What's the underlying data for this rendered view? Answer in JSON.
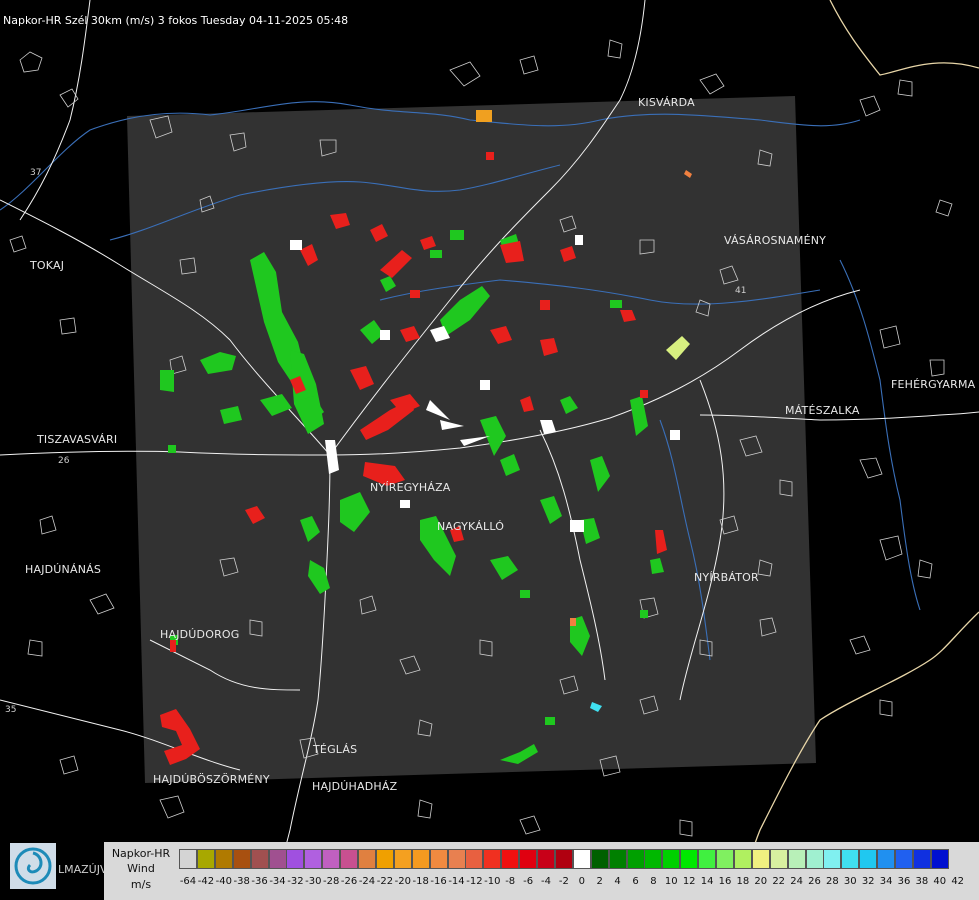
{
  "header": {
    "title": "Napkor-HR Szél 30km (m/s) 3 fokos Tuesday 04-11-2025 05:48"
  },
  "cities": [
    {
      "id": "kisvarda",
      "label": "KISVÁRDA"
    },
    {
      "id": "tokaj",
      "label": "TOKAJ"
    },
    {
      "id": "vasarosnameny",
      "label": "VÁSÁROSNAMÉNY"
    },
    {
      "id": "fehergyarmat",
      "label": "FEHÉRGYARMA"
    },
    {
      "id": "mateszalka",
      "label": "MÁTÉSZALKA"
    },
    {
      "id": "tiszavasvari",
      "label": "TISZAVASVÁRI"
    },
    {
      "id": "nyiregyhaza",
      "label": "NYÍREGYHÁZA"
    },
    {
      "id": "nagykallo",
      "label": "NAGYKÁLLÓ"
    },
    {
      "id": "hajdunanas",
      "label": "HAJDÚNÁNÁS"
    },
    {
      "id": "nyirbator",
      "label": "NYÍRBÁTOR"
    },
    {
      "id": "hajdudorog",
      "label": "HAJDÚDOROG"
    },
    {
      "id": "teglas",
      "label": "TÉGLÁS"
    },
    {
      "id": "hajduboszormeny",
      "label": "HAJDÚBÖSZÖRMÉNY"
    },
    {
      "id": "hajduhadhaz",
      "label": "HAJDÚHADHÁZ"
    }
  ],
  "road_labels": {
    "r26": "26",
    "r41": "41",
    "r35": "35",
    "r37": "37"
  },
  "logo": {
    "text": "LMAZÚJVÁR",
    "icon": "swirl-logo-icon"
  },
  "legend": {
    "title_lines": [
      "Napkor-HR",
      "Wind",
      "m/s"
    ],
    "colors": [
      "#d4d4d4",
      "#a8a800",
      "#b07a00",
      "#a85010",
      "#a05050",
      "#a05090",
      "#a050e0",
      "#b060e0",
      "#c060c0",
      "#c85090",
      "#e08040",
      "#f0a000",
      "#f4a020",
      "#f49a20",
      "#f08a40",
      "#e88050",
      "#e86040",
      "#f03020",
      "#f01010",
      "#e00010",
      "#c80018",
      "#b00010",
      "#ffffff",
      "#006000",
      "#008000",
      "#00a000",
      "#00b800",
      "#00d000",
      "#00e800",
      "#40f040",
      "#80f060",
      "#b0f060",
      "#f0f080",
      "#d8f0a0",
      "#b8f0b8",
      "#a0f0d0",
      "#80f0f0",
      "#40e0f0",
      "#20c8f0",
      "#2090f0",
      "#2060f0",
      "#1030e0",
      "#0010d0"
    ],
    "ticks": [
      "-64",
      "-42",
      "-40",
      "-38",
      "-36",
      "-34",
      "-32",
      "-30",
      "-28",
      "-26",
      "-24",
      "-22",
      "-20",
      "-18",
      "-16",
      "-14",
      "-12",
      "-10",
      "-8",
      "-6",
      "-4",
      "-2",
      "0",
      "2",
      "4",
      "6",
      "8",
      "10",
      "12",
      "14",
      "16",
      "18",
      "20",
      "22",
      "24",
      "26",
      "28",
      "30",
      "32",
      "34",
      "36",
      "38",
      "40",
      "42"
    ]
  }
}
